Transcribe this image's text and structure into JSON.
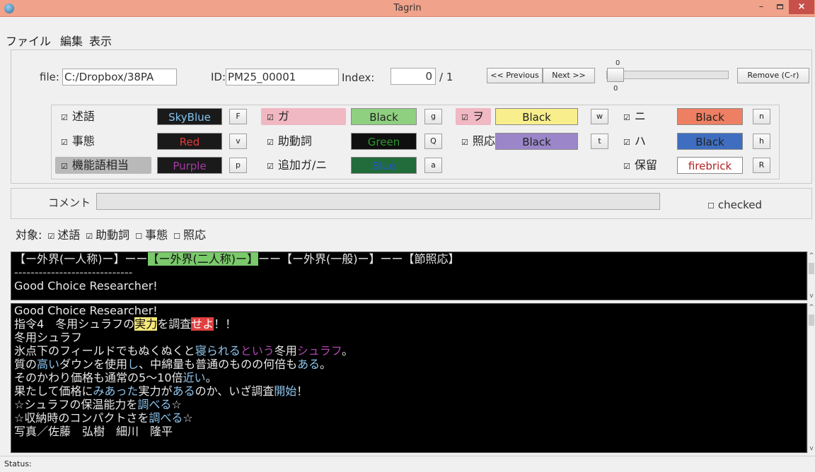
{
  "window": {
    "title": "Tagrin",
    "min": "–",
    "close": "×"
  },
  "menu": [
    "ファイル",
    "編集",
    "表示"
  ],
  "toolbar": {
    "file_label": "file:",
    "file_value": "C:/Dropbox/38PA",
    "id_label": "ID:",
    "id_value": "PM25_00001",
    "index_label": "Index:",
    "index_value": "0",
    "index_total": "/ 1",
    "prev_label": "<< Previous",
    "next_label": "Next >>",
    "slider_top": "0",
    "slider_bottom": "0",
    "slider_value": 0,
    "remove_label": "Remove (C-r)"
  },
  "tags": [
    {
      "label": "述語",
      "color": "SkyBlue",
      "key": "F",
      "checked": true
    },
    {
      "label": "事態",
      "color": "Red",
      "key": "v",
      "checked": true
    },
    {
      "label": "機能語相当",
      "color": "Purple",
      "key": "p",
      "checked": true
    },
    {
      "label": "ガ",
      "color": "Black",
      "key": "g",
      "checked": true
    },
    {
      "label": "助動詞",
      "color": "Green",
      "key": "Q",
      "checked": true
    },
    {
      "label": "追加ガ/ニ",
      "color": "Blue",
      "key": "a",
      "checked": true
    },
    {
      "label": "ヲ",
      "color": "Black",
      "key": "w",
      "checked": true
    },
    {
      "label": "照応",
      "color": "Black",
      "key": "t",
      "checked": true
    },
    {
      "label": "ニ",
      "color": "Black",
      "key": "n",
      "checked": true
    },
    {
      "label": "ハ",
      "color": "Black",
      "key": "h",
      "checked": true
    },
    {
      "label": "保留",
      "color": "firebrick",
      "key": "R",
      "checked": true
    }
  ],
  "colors": {
    "skyblue_bg": "#1a1a1a",
    "skyblue_fg": "#7fc4ee",
    "red_bg": "#1a1a1a",
    "red_fg": "#e23a3a",
    "purple_bg": "#1a1a1a",
    "purple_fg": "#a43aa4",
    "ga_bg": "#8fd080",
    "wo_bg": "#f9ee8c",
    "shoou_bg": "#9a86c9",
    "ni_bg": "#ee7f62",
    "ha_bg": "#3f6ec0",
    "firebrick_bg": "#ffffff",
    "firebrick_fg": "#b22222",
    "green_bg": "#0f0f0f",
    "green_fg": "#2e9a2e",
    "blue_bg": "#226b3a",
    "blue_fg": "#2255cc",
    "ga_label_bg": "#f0b8c2",
    "wo_label_bg": "#f0b8c2",
    "kinougo_label_bg": "#b9b9b9"
  },
  "comment": {
    "label": "コメント",
    "value": "",
    "checked_label": "checked",
    "checked": false
  },
  "target": {
    "label": "対象:",
    "items": [
      {
        "label": "述語",
        "checked": true
      },
      {
        "label": "助動詞",
        "checked": true
      },
      {
        "label": "事態",
        "checked": false
      },
      {
        "label": "照応",
        "checked": false
      }
    ]
  },
  "pane1": {
    "seg1": "【ー外界(一人称)ー】ーー",
    "seg2": "【ー外界(二人称)ー】",
    "seg3": "ーー【ー外界(一般)ー】ーー【節照応】",
    "dashes": "-----------------------------",
    "line3": "Good Choice Researcher!"
  },
  "pane2": {
    "l1": "Good Choice Researcher!",
    "l2a": "指令4　冬用シュラフの",
    "l2b": "実力",
    "l2c": "を調査",
    "l2d": "せよ",
    "l2e": "！！",
    "l3": "冬用シュラフ",
    "l4a": "氷点下のフィールドでもぬくぬくと",
    "l4b": "寝られる",
    "l4c": "という",
    "l4d": "冬用",
    "l4e": "シュラフ",
    "l4f": "。",
    "l5a": "質の",
    "l5b": "高い",
    "l5c": "ダウンを使用",
    "l5d": "し",
    "l5e": "、中綿量も普通のものの何倍も",
    "l5f": "ある",
    "l5g": "。",
    "l6a": "そのかわり価格も通常の5〜10倍",
    "l6b": "近い",
    "l6c": "。",
    "l7a": "果たして価格に",
    "l7b": "みあった",
    "l7c": "実力が",
    "l7d": "ある",
    "l7e": "のか、いざ調査",
    "l7f": "開始",
    "l7g": "！",
    "l8a": "☆シュラフの保温能力を",
    "l8b": "調べる",
    "l8c": "☆",
    "l9a": "☆収納時のコンパクトさを",
    "l9b": "調べる",
    "l9c": "☆",
    "l10": "写真／佐藤　弘樹　細川　隆平"
  },
  "status": {
    "label": "Status:"
  }
}
